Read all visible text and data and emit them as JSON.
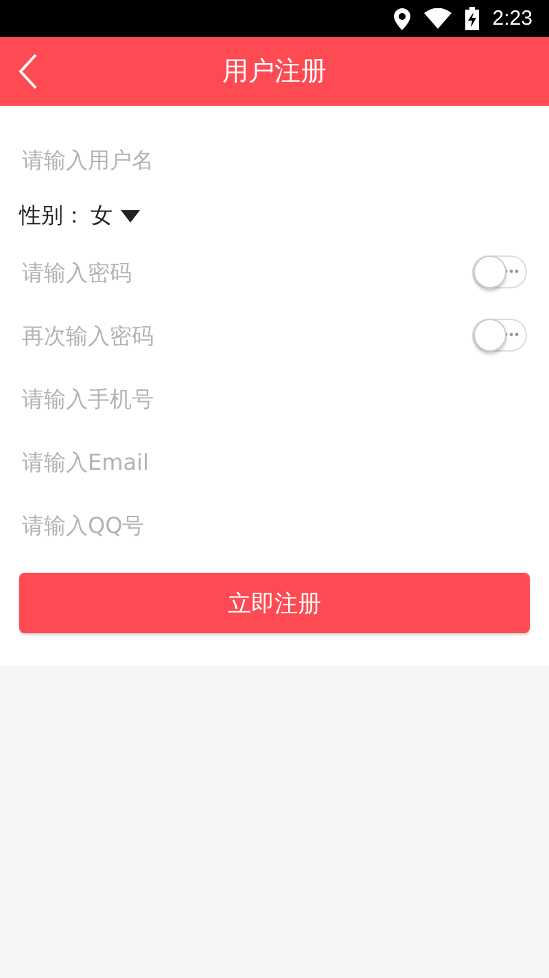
{
  "status_bar": {
    "time": "2:23"
  },
  "header": {
    "title": "用户注册"
  },
  "fields": [
    {
      "kind": "input",
      "placeholder": "请输入用户名"
    },
    {
      "kind": "select",
      "label": "性别：",
      "value": "女"
    },
    {
      "kind": "password",
      "placeholder": "请输入密码",
      "visible": false
    },
    {
      "kind": "password",
      "placeholder": "再次输入密码",
      "visible": false
    },
    {
      "kind": "input",
      "placeholder": "请输入手机号"
    },
    {
      "kind": "input",
      "placeholder": "请输入Email"
    },
    {
      "kind": "input",
      "placeholder": "请输入QQ号"
    }
  ],
  "submit_button": "立即注册"
}
